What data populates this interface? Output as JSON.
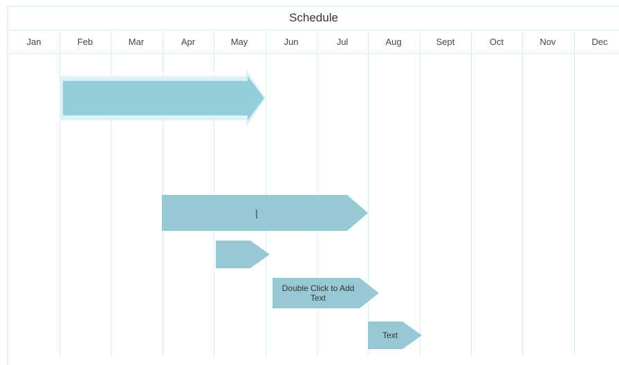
{
  "title": "Schedule",
  "months": [
    "Jan",
    "Feb",
    "Mar",
    "Apr",
    "May",
    "Jun",
    "Jul",
    "Aug",
    "Sept",
    "Oct",
    "Nov",
    "Dec"
  ],
  "colors": {
    "bar": "#96c9d4",
    "bar_selected": "#95cedb",
    "selection_glow": "#dff0f6",
    "grid": "#d8eef2"
  },
  "tasks": [
    {
      "id": "task-1",
      "label": "",
      "selected": true
    },
    {
      "id": "task-2",
      "label": "|",
      "selected": false
    },
    {
      "id": "task-3",
      "label": "",
      "selected": false
    },
    {
      "id": "task-4",
      "label": "Double Click to Add Text",
      "selected": false
    },
    {
      "id": "task-5",
      "label": "Text",
      "selected": false
    }
  ]
}
